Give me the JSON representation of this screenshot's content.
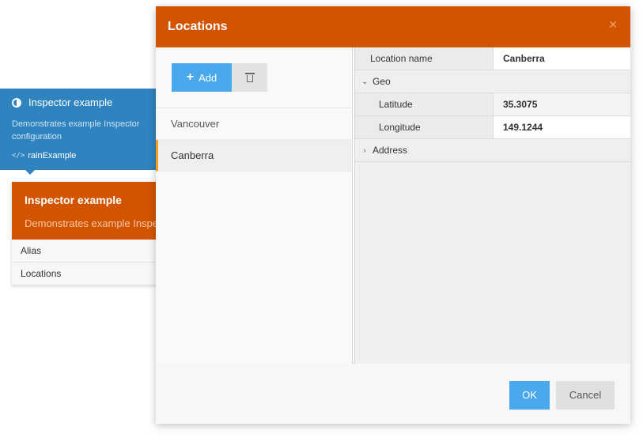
{
  "widget": {
    "title": "Inspector example",
    "icon": "contrast-icon",
    "description": "Demonstrates example Inspector configuration",
    "code_glyph": "</>",
    "code_name": "rainExample",
    "color": "#2f84bf"
  },
  "inspector": {
    "title": "Inspector example",
    "description": "Demonstrates example Inspector",
    "rows": [
      {
        "label": "Alias"
      },
      {
        "label": "Locations"
      }
    ],
    "color": "#d35400"
  },
  "modal": {
    "title": "Locations",
    "close_glyph": "✕",
    "toolbar": {
      "add_label": "Add",
      "add_icon": "plus-icon",
      "delete_icon": "trash-icon"
    },
    "locations": [
      {
        "name": "Vancouver",
        "active": false
      },
      {
        "name": "Canberra",
        "active": true
      }
    ],
    "properties": {
      "location_name": {
        "label": "Location name",
        "value": "Canberra"
      },
      "geo": {
        "label": "Geo",
        "expanded": true,
        "latitude": {
          "label": "Latitude",
          "value": "35.3075"
        },
        "longitude": {
          "label": "Longitude",
          "value": "149.1244"
        }
      },
      "address": {
        "label": "Address",
        "expanded": false
      }
    },
    "footer": {
      "ok_label": "OK",
      "cancel_label": "Cancel"
    }
  },
  "colors": {
    "primary_button": "#4aa8ec",
    "header": "#d35400",
    "active_accent": "#f0a020"
  }
}
